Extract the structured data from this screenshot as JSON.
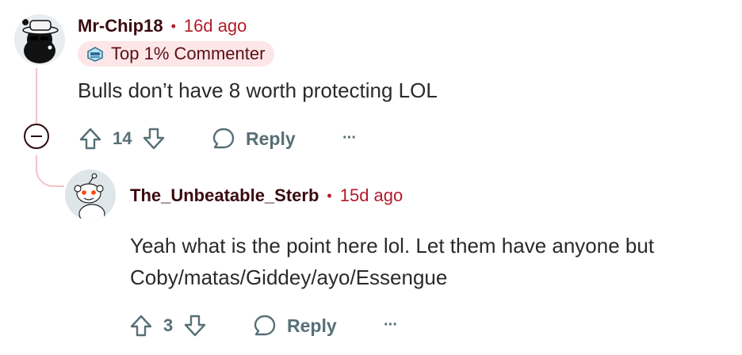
{
  "comment1": {
    "username": "Mr-Chip18",
    "separator": "•",
    "time": "16d ago",
    "badge": "Top 1% Commenter",
    "body": "Bulls don’t have 8 worth protecting LOL",
    "score": "14",
    "reply_label": "Reply",
    "more": "···"
  },
  "comment2": {
    "username": "The_Unbeatable_Sterb",
    "separator": "•",
    "time": "15d ago",
    "body_line1": "Yeah what is the point here lol. Let them have anyone but",
    "body_line2": "Coby/matas/Giddey/ayo/Essengue",
    "score": "3",
    "reply_label": "Reply",
    "more": "···"
  },
  "colors": {
    "username": "#3a0a0f",
    "time": "#b21b2b",
    "badge_bg": "#fde6e7",
    "action": "#576f76",
    "thread_line": "#f2c4c9"
  }
}
